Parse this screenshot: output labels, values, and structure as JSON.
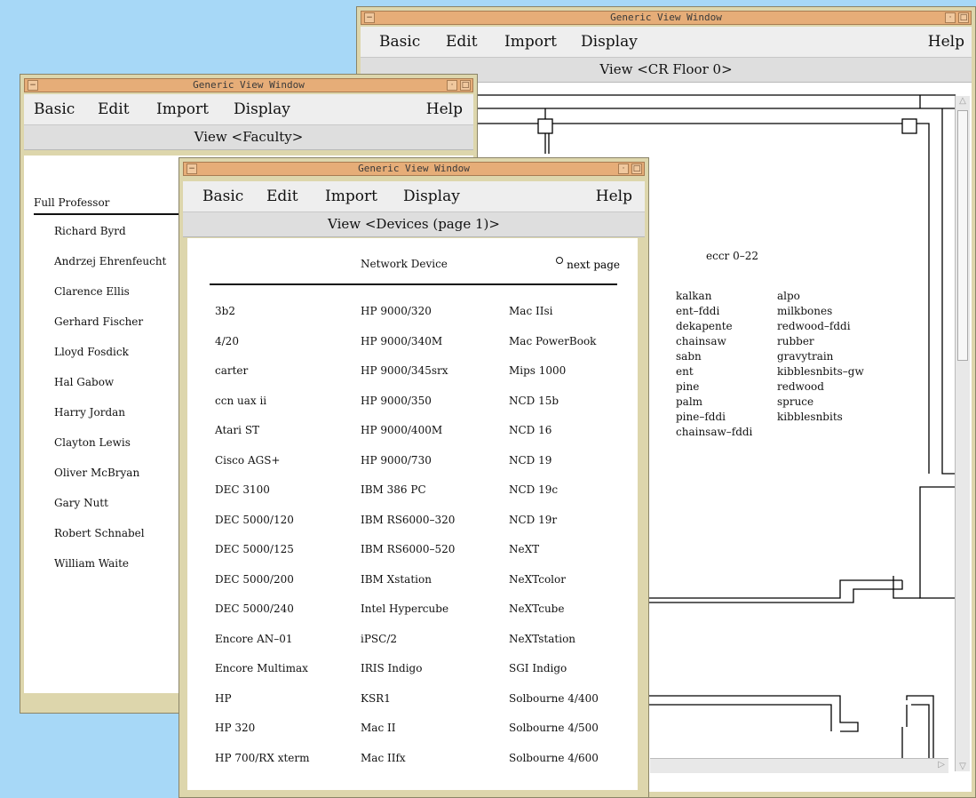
{
  "menu": {
    "basic": "Basic",
    "edit": "Edit",
    "import": "Import",
    "display": "Display",
    "help": "Help"
  },
  "window_title": "Generic View Window",
  "floor_window": {
    "view_label": "View <CR Floor 0>",
    "room_label": "eccr 0–22",
    "devices_col1": [
      "kalkan",
      "ent–fddi",
      "dekapente",
      "chainsaw",
      "sabn",
      "ent",
      "pine",
      "palm",
      "pine–fddi",
      "chainsaw–fddi"
    ],
    "devices_col2": [
      "alpo",
      "milkbones",
      "redwood–fddi",
      "rubber",
      "gravytrain",
      "kibblesnbits–gw",
      "redwood",
      "spruce",
      "kibblesnbits"
    ]
  },
  "faculty_window": {
    "view_label": "View <Faculty>",
    "header": "Full Professor",
    "names": [
      "Richard Byrd",
      "Andrzej Ehrenfeucht",
      "Clarence Ellis",
      "Gerhard Fischer",
      "Lloyd Fosdick",
      "Hal Gabow",
      "Harry Jordan",
      "Clayton Lewis",
      "Oliver McBryan",
      "Gary Nutt",
      "Robert Schnabel",
      "William Waite"
    ]
  },
  "devices_window": {
    "view_label": "View <Devices (page 1)>",
    "header": "Network Device",
    "next_page": "next page",
    "col1": [
      "3b2",
      "4/20",
      "carter",
      "ccn uax ii",
      "Atari ST",
      "Cisco AGS+",
      "DEC 3100",
      "DEC 5000/120",
      "DEC 5000/125",
      "DEC 5000/200",
      "DEC 5000/240",
      "Encore AN–01",
      "Encore Multimax",
      "HP",
      "HP 320",
      "HP 700/RX xterm"
    ],
    "col2": [
      "HP 9000/320",
      "HP 9000/340M",
      "HP 9000/345srx",
      "HP 9000/350",
      "HP 9000/400M",
      "HP 9000/730",
      "IBM 386 PC",
      "IBM RS6000–320",
      "IBM RS6000–520",
      "IBM Xstation",
      "Intel Hypercube",
      "iPSC/2",
      "IRIS Indigo",
      "KSR1",
      "Mac II",
      "Mac IIfx"
    ],
    "col3": [
      "Mac IIsi",
      "Mac PowerBook",
      "Mips 1000",
      "NCD 15b",
      "NCD 16",
      "NCD 19",
      "NCD 19c",
      "NCD 19r",
      "NeXT",
      "NeXTcolor",
      "NeXTcube",
      "NeXTstation",
      "SGI Indigo",
      "Solbourne 4/400",
      "Solbourne 4/500",
      "Solbourne 4/600"
    ]
  }
}
